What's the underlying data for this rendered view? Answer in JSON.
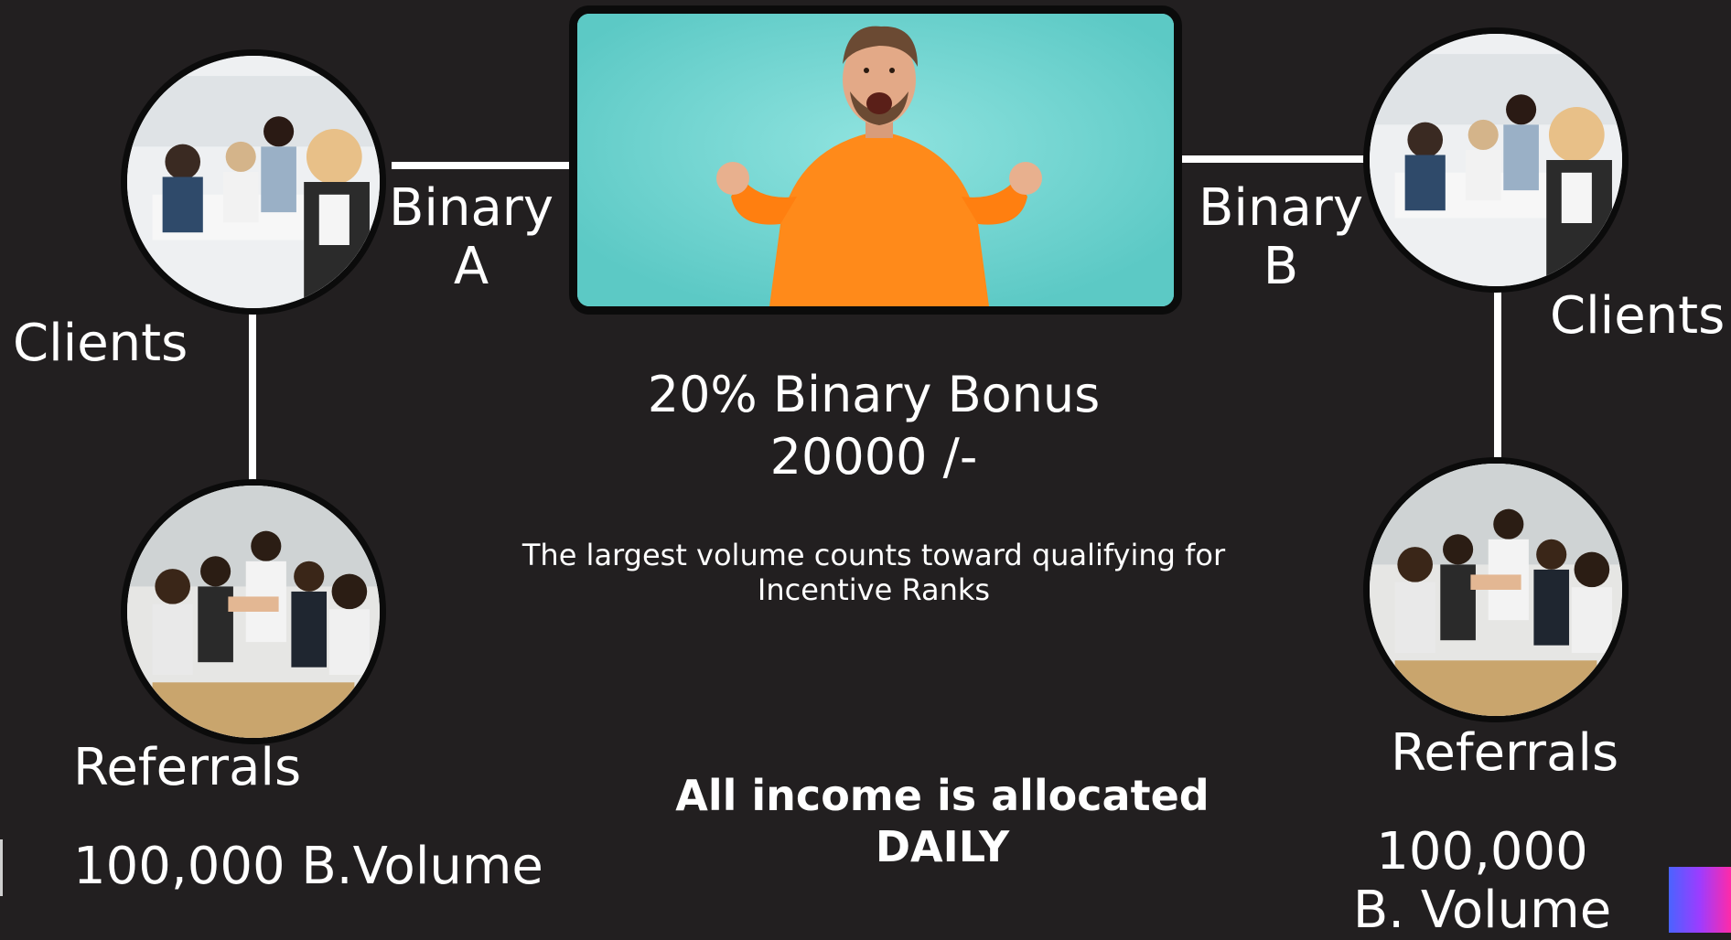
{
  "left": {
    "binary_line1": "Binary",
    "binary_line2": "A",
    "clients": "Clients",
    "referrals": "Referrals",
    "volume": "100,000  B.Volume"
  },
  "right": {
    "binary_line1": "Binary",
    "binary_line2": "B",
    "clients": "Clients",
    "referrals": "Referrals",
    "volume_line1": "100,000",
    "volume_line2": "B. Volume"
  },
  "center": {
    "bonus_title": "20% Binary Bonus",
    "bonus_amount": "20000 /-",
    "note_line1": "The largest volume counts toward qualifying for",
    "note_line2": "Incentive Ranks",
    "allocation_line1": "All income is allocated",
    "allocation_line2": "DAILY"
  },
  "colors": {
    "background": "#221f20",
    "hero_background": "#75d8d4",
    "sweater": "#ff8a1a",
    "accent_gradient": [
      "#4a63ff",
      "#9d3cff",
      "#ff2aa8"
    ]
  },
  "images": {
    "hero": "excited-man-orange-sweater",
    "clients": "office-team-meeting-photo",
    "referrals": "team-high-five-photo"
  }
}
